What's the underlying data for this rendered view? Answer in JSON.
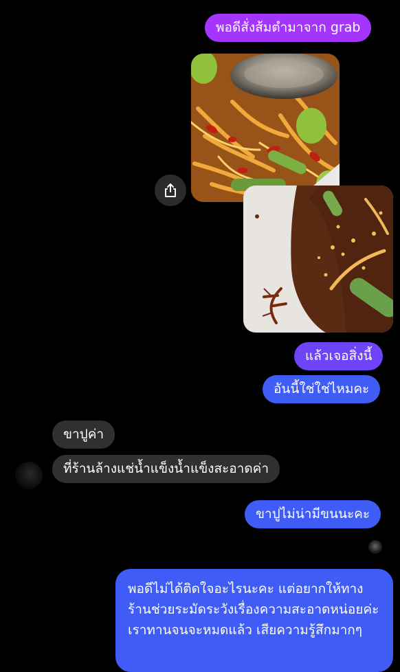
{
  "messages": [
    {
      "id": "m1",
      "sender": "me",
      "text": "พอดีสั่งส้มตำมาจาก grab"
    },
    {
      "id": "m2",
      "sender": "me",
      "type": "image",
      "alt": "ส้มตำ"
    },
    {
      "id": "m3",
      "sender": "me",
      "type": "image",
      "alt": "น้ำส้มตำก้นจาน"
    },
    {
      "id": "m4",
      "sender": "me",
      "text": "แล้วเจอสิ่งนี้"
    },
    {
      "id": "m5",
      "sender": "me",
      "text": "อันนี้ใช่ใช่ไหมคะ"
    },
    {
      "id": "m6",
      "sender": "them",
      "text": "ขาปูค่า"
    },
    {
      "id": "m7",
      "sender": "them",
      "text": "ที่ร้านล้างแช่น้ำแข็งน้ำแข็งสะอาดค่า"
    },
    {
      "id": "m8",
      "sender": "me",
      "text": "ขาปูไม่น่ามีขนนะคะ"
    },
    {
      "id": "m9",
      "sender": "me",
      "text": "พอดีไม่ได้ติดใจอะไรนะคะ แต่อยากให้ทางร้านช่วยระมัดระวังเรื่องความสะอาดหน่อยค่ะ เราทานจนจะหมดแล้ว เสียความรู้สึกมากๆ"
    }
  ],
  "colors": {
    "background": "#000000",
    "outgoing_purple": "#a634ff",
    "outgoing_violet": "#6f44f8",
    "outgoing_blue": "#3f5df6",
    "incoming": "#303030"
  },
  "icons": {
    "share": "share-icon",
    "avatar": "contact-avatar",
    "seen": "seen-avatar"
  }
}
